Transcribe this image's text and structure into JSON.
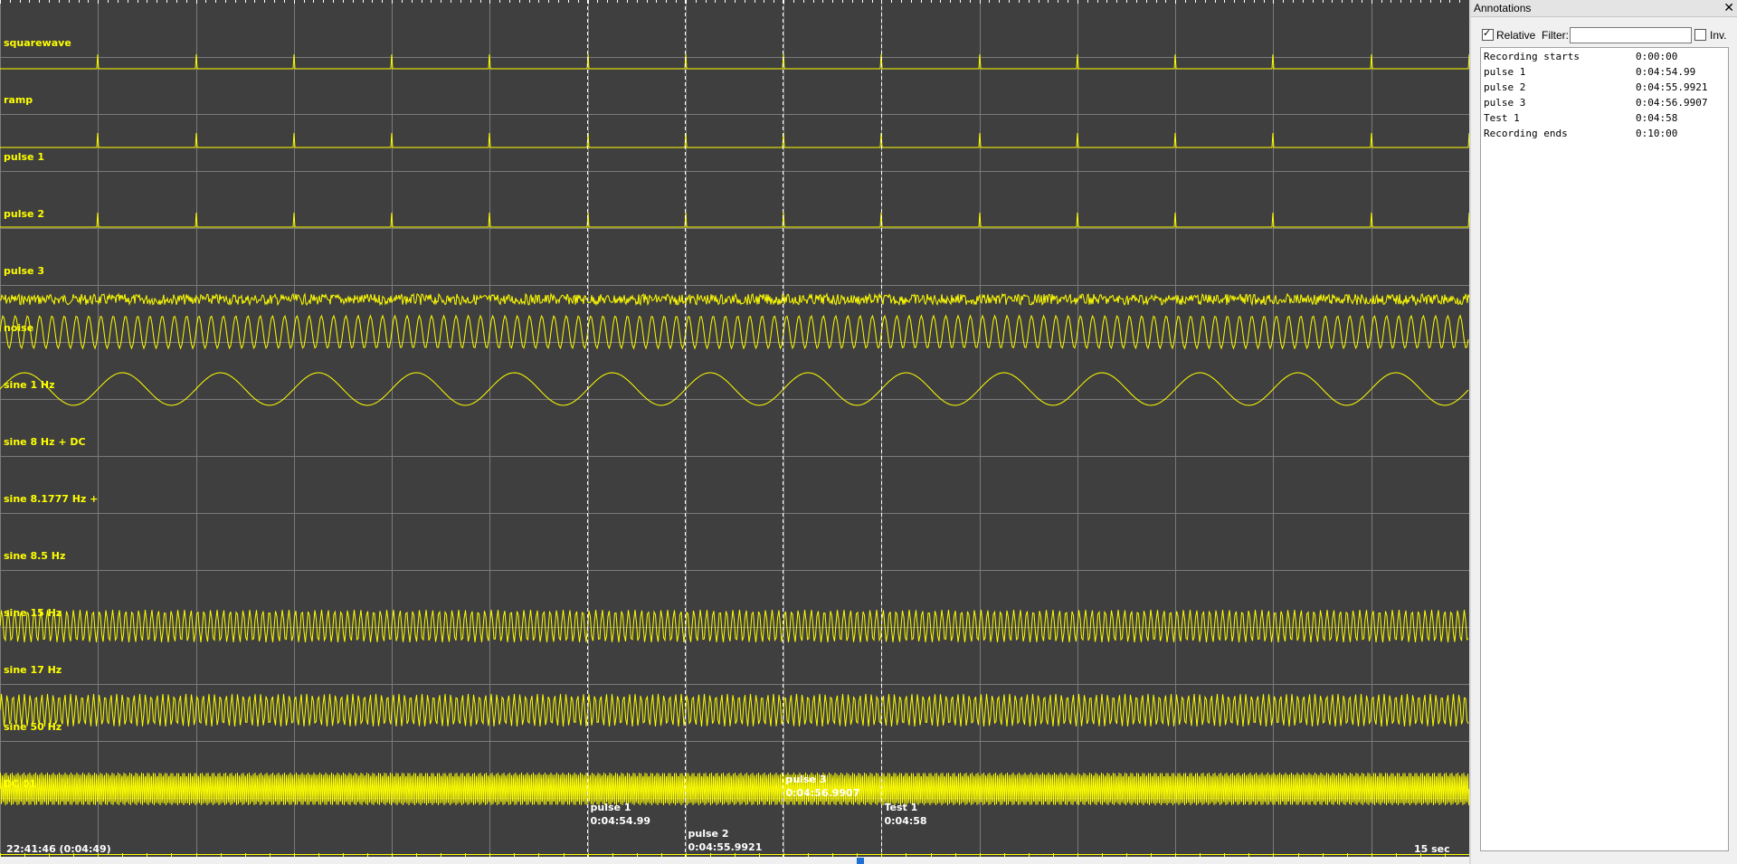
{
  "signals": [
    {
      "label": "squarewave",
      "kind": "squarewave"
    },
    {
      "label": "ramp",
      "kind": "ramp"
    },
    {
      "label": "pulse 1",
      "kind": "pulse"
    },
    {
      "label": "pulse 2",
      "kind": "pulse"
    },
    {
      "label": "pulse 3",
      "kind": "flat"
    },
    {
      "label": "noise",
      "kind": "noise"
    },
    {
      "label": "sine 1 Hz",
      "kind": "sine",
      "freq_hz": 8
    },
    {
      "label": "sine 8 Hz + DC",
      "kind": "sine",
      "freq_hz": 1
    },
    {
      "label": "sine 8.1777 Hz +",
      "kind": "flat"
    },
    {
      "label": "sine 8.5 Hz",
      "kind": "flat"
    },
    {
      "label": "sine 15 Hz",
      "kind": "flat"
    },
    {
      "label": "sine 17 Hz",
      "kind": "sine",
      "freq_hz": 15
    },
    {
      "label": "sine 50 Hz",
      "kind": "sine",
      "freq_hz": 17
    },
    {
      "label": "DC 01",
      "kind": "flat"
    }
  ],
  "bottom_trace": {
    "kind": "sine",
    "freq_hz": 50
  },
  "annotation_markers": [
    {
      "name": "pulse 1",
      "time": "0:04:54.99",
      "offset_s": 5.99,
      "label_row": 0
    },
    {
      "name": "pulse 2",
      "time": "0:04:55.9921",
      "offset_s": 6.9921,
      "label_row": 1
    },
    {
      "name": "pulse 3",
      "time": "0:04:56.9907",
      "offset_s": 7.9907,
      "label_row": -1
    },
    {
      "name": "Test 1",
      "time": "0:04:58",
      "offset_s": 9.0,
      "label_row": 0
    }
  ],
  "timebase": {
    "start_clock": "22:41:46 (0:04:49)",
    "page_span_label": "15 sec",
    "page_seconds": 15
  },
  "colors": {
    "background": "#3f3f3f",
    "trace": "#ffff00",
    "grid": "#7a7a7a",
    "marker": "#ffffff"
  },
  "panel": {
    "title": "Annotations",
    "close_glyph": "✕",
    "relative_label": "Relative",
    "relative_checked": true,
    "filter_label": "Filter:",
    "filter_value": "",
    "inv_label": "Inv.",
    "inv_checked": false,
    "rows": [
      {
        "name": "Recording starts",
        "time": "0:00:00"
      },
      {
        "name": "pulse 1",
        "time": "0:04:54.99"
      },
      {
        "name": "pulse 2",
        "time": "0:04:55.9921"
      },
      {
        "name": "pulse 3",
        "time": "0:04:56.9907"
      },
      {
        "name": "Test 1",
        "time": "0:04:58"
      },
      {
        "name": "Recording ends",
        "time": "0:10:00"
      }
    ]
  }
}
